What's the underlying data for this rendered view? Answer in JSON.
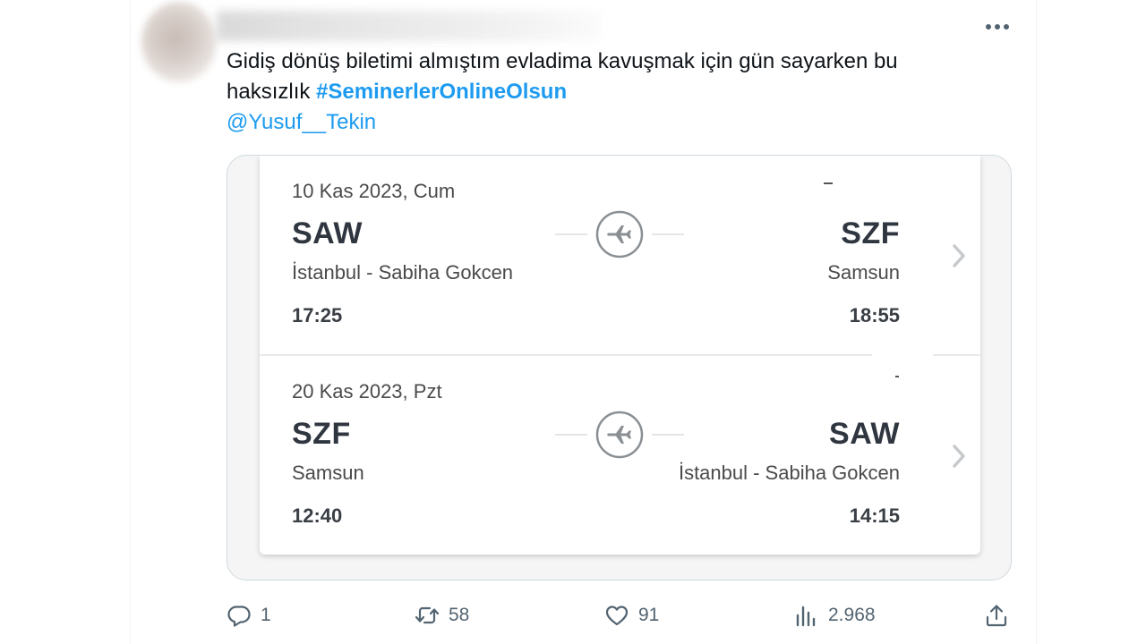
{
  "tweet": {
    "text_line1": "Gidiş dönüş biletimi almıştım evladima kavuşmak için gün sayarken bu",
    "text_line2_prefix": "haksızlık ",
    "hashtag": "#SeminerlerOnlineOlsun",
    "mention": "@Yusuf__Tekin",
    "more_icon": "more-horizontal-icon"
  },
  "flights": [
    {
      "date": "10 Kas 2023, Cum",
      "from_code": "SAW",
      "from_city": "İstanbul - Sabiha Gokcen",
      "departure_time": "17:25",
      "to_code": "SZF",
      "to_city": "Samsun",
      "arrival_time": "18:55"
    },
    {
      "date": "20 Kas 2023, Pzt",
      "from_code": "SZF",
      "from_city": "Samsun",
      "departure_time": "12:40",
      "to_code": "SAW",
      "to_city": "İstanbul - Sabiha Gokcen",
      "arrival_time": "14:15"
    }
  ],
  "actions": {
    "replies": "1",
    "retweets": "58",
    "likes": "91",
    "views": "2.968"
  },
  "colors": {
    "link": "#1d9bf0",
    "text": "#0f1419",
    "muted": "#536471",
    "ticket_text": "#2f3640"
  }
}
